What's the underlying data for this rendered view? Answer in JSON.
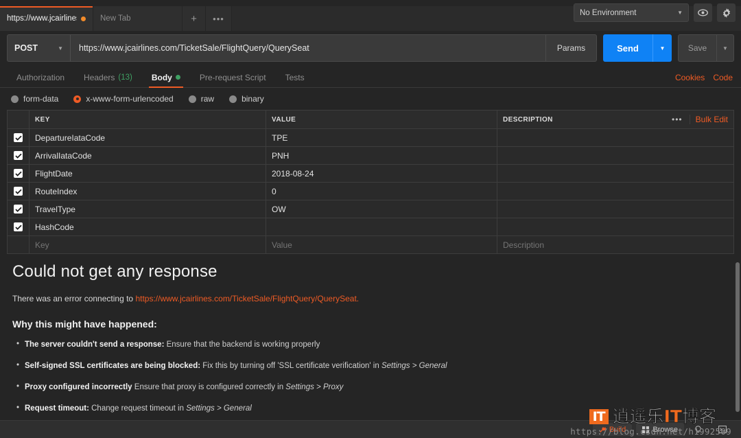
{
  "window": {
    "tabs": [
      {
        "label": "https://www.jcairlines.",
        "unsaved": true,
        "active": true
      },
      {
        "label": "New Tab",
        "unsaved": false,
        "active": false
      }
    ],
    "new_tab_button": "+",
    "tab_options_button": "•••"
  },
  "environment": {
    "selected": "No Environment",
    "caret": "▼",
    "eye_icon": "eye-icon",
    "gear_icon": "gear-icon"
  },
  "request": {
    "method": "POST",
    "method_caret": "▼",
    "url": "https://www.jcairlines.com/TicketSale/FlightQuery/QuerySeat",
    "params_label": "Params",
    "send_label": "Send",
    "send_caret": "▼",
    "save_label": "Save",
    "save_caret": "▼"
  },
  "request_tabs": {
    "items": [
      {
        "label": "Authorization",
        "count": "",
        "dot": false,
        "active": false
      },
      {
        "label": "Headers",
        "count": "(13)",
        "dot": false,
        "active": false
      },
      {
        "label": "Body",
        "count": "",
        "dot": true,
        "active": true
      },
      {
        "label": "Pre-request Script",
        "count": "",
        "dot": false,
        "active": false
      },
      {
        "label": "Tests",
        "count": "",
        "dot": false,
        "active": false
      }
    ],
    "cookies_label": "Cookies",
    "code_label": "Code"
  },
  "body_types": [
    {
      "label": "form-data",
      "selected": false
    },
    {
      "label": "x-www-form-urlencoded",
      "selected": true
    },
    {
      "label": "raw",
      "selected": false
    },
    {
      "label": "binary",
      "selected": false
    }
  ],
  "params_table": {
    "headers": {
      "key": "KEY",
      "value": "VALUE",
      "description": "DESCRIPTION"
    },
    "options_button": "•••",
    "bulk_edit_label": "Bulk Edit",
    "rows": [
      {
        "checked": true,
        "key": "DepartureIataCode",
        "value": "TPE",
        "description": ""
      },
      {
        "checked": true,
        "key": "ArrivalIataCode",
        "value": "PNH",
        "description": ""
      },
      {
        "checked": true,
        "key": "FlightDate",
        "value": "2018-08-24",
        "description": ""
      },
      {
        "checked": true,
        "key": "RouteIndex",
        "value": "0",
        "description": ""
      },
      {
        "checked": true,
        "key": "TravelType",
        "value": "OW",
        "description": ""
      },
      {
        "checked": true,
        "key": "HashCode",
        "value": "",
        "description": ""
      }
    ],
    "placeholder_row": {
      "key": "Key",
      "value": "Value",
      "description": "Description"
    }
  },
  "response_error": {
    "title": "Could not get any response",
    "subtitle_prefix": "There was an error connecting to ",
    "subtitle_link": "https://www.jcairlines.com/TicketSale/FlightQuery/QuerySeat.",
    "why_heading": "Why this might have happened:",
    "reasons": [
      {
        "bold": "The server couldn't send a response:",
        "rest": " Ensure that the backend is working properly",
        "italic": ""
      },
      {
        "bold": "Self-signed SSL certificates are being blocked:",
        "rest": " Fix this by turning off 'SSL certificate verification' in ",
        "italic": "Settings > General"
      },
      {
        "bold": "Proxy configured incorrectly",
        "rest": " Ensure that proxy is configured correctly in ",
        "italic": "Settings > Proxy"
      },
      {
        "bold": "Request timeout:",
        "rest": " Change request timeout in ",
        "italic": "Settings > General"
      }
    ]
  },
  "bottom_bar": {
    "build_label": "Build",
    "browse_label": "Browse",
    "build_icon": "wrench-icon",
    "browse_icon": "grid-icon",
    "bulb_icon": "bulb-icon",
    "console_icon": "console-icon"
  },
  "watermark": {
    "badge": "IT",
    "text_a": "逍遥乐",
    "text_b": "IT",
    "text_c": "博客",
    "url": "https://blog.csdn.net/h1992509"
  },
  "colors": {
    "accent": "#ef5b25",
    "send_blue": "#0f82f5",
    "green": "#3fa063",
    "bg": "#252525",
    "panel": "#2a2a2a"
  }
}
